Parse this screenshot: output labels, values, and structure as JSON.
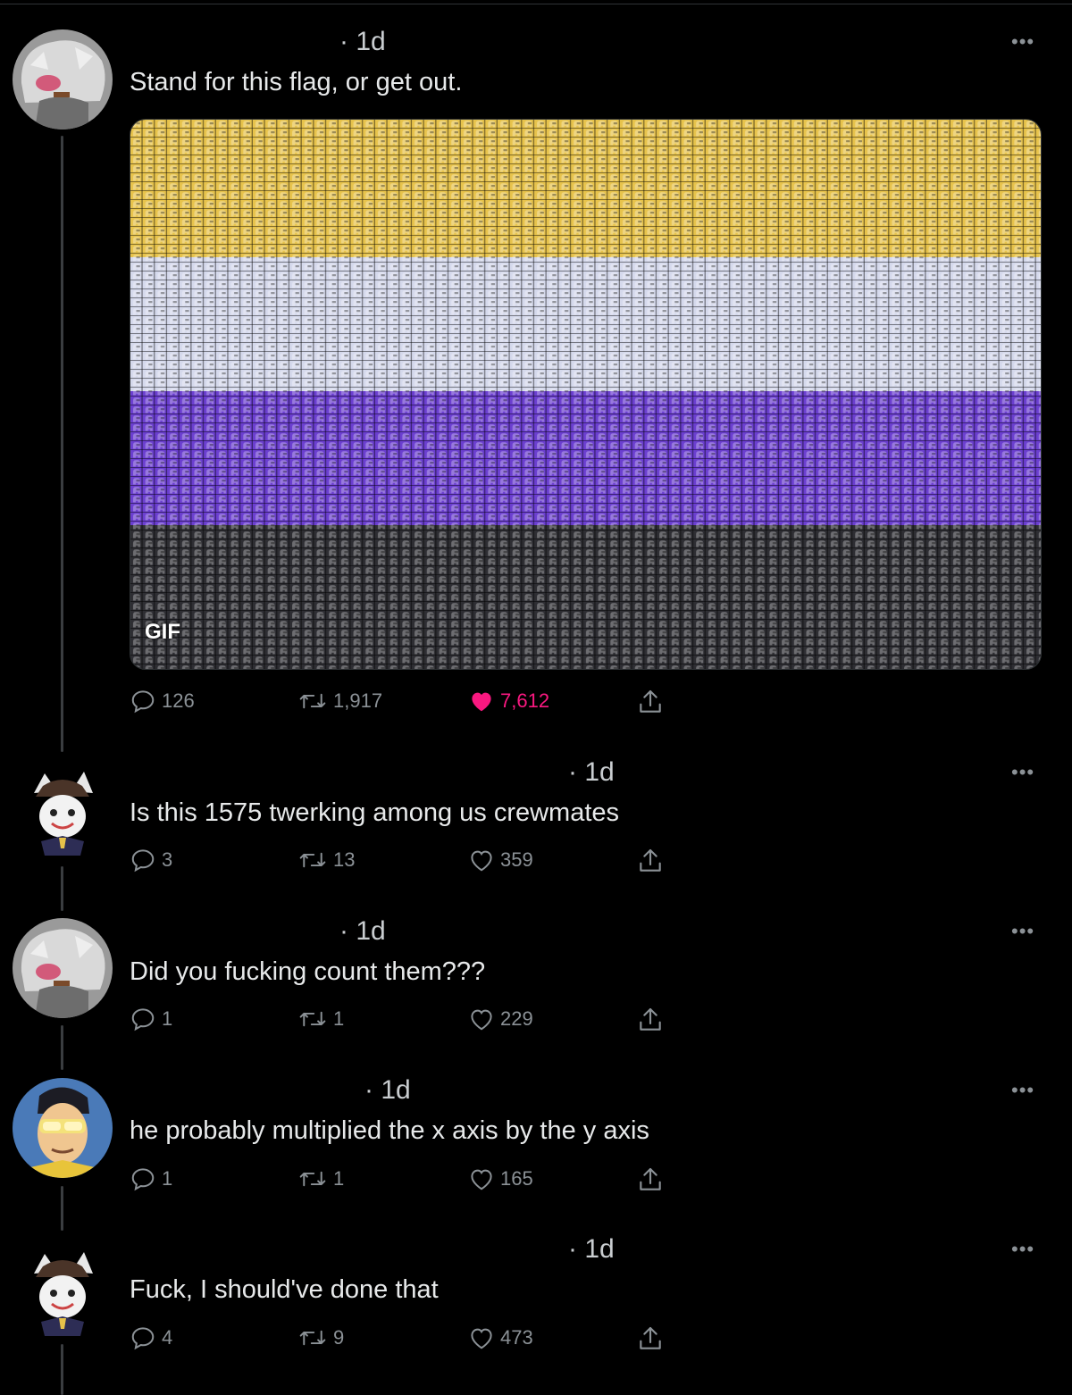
{
  "colors": {
    "background": "#000000",
    "text": "#e7e9ea",
    "muted": "#8b9196",
    "like_active": "#f91880",
    "flag_yellow": "#e7c34c",
    "flag_white": "#d5d9ec",
    "flag_purple": "#6b3fd0",
    "flag_black": "#2e2e33"
  },
  "posts": [
    {
      "time": "· 1d",
      "text": "Stand for this flag, or get out.",
      "media_badge": "GIF",
      "replies": "126",
      "retweets": "1,917",
      "likes": "7,612",
      "liked": true
    },
    {
      "time": "· 1d",
      "text": "Is this 1575 twerking among us crewmates",
      "replies": "3",
      "retweets": "13",
      "likes": "359",
      "liked": false
    },
    {
      "time": "· 1d",
      "text": "Did you fucking count them???",
      "replies": "1",
      "retweets": "1",
      "likes": "229",
      "liked": false
    },
    {
      "time": "· 1d",
      "text": "he probably multiplied the x axis by the y axis",
      "replies": "1",
      "retweets": "1",
      "likes": "165",
      "liked": false
    },
    {
      "time": "· 1d",
      "text": "Fuck, I should've done that",
      "replies": "4",
      "retweets": "9",
      "likes": "473",
      "liked": false
    }
  ],
  "icons": {
    "more": "more-icon",
    "reply": "reply-icon",
    "retweet": "retweet-icon",
    "like": "heart-icon",
    "share": "share-icon"
  }
}
